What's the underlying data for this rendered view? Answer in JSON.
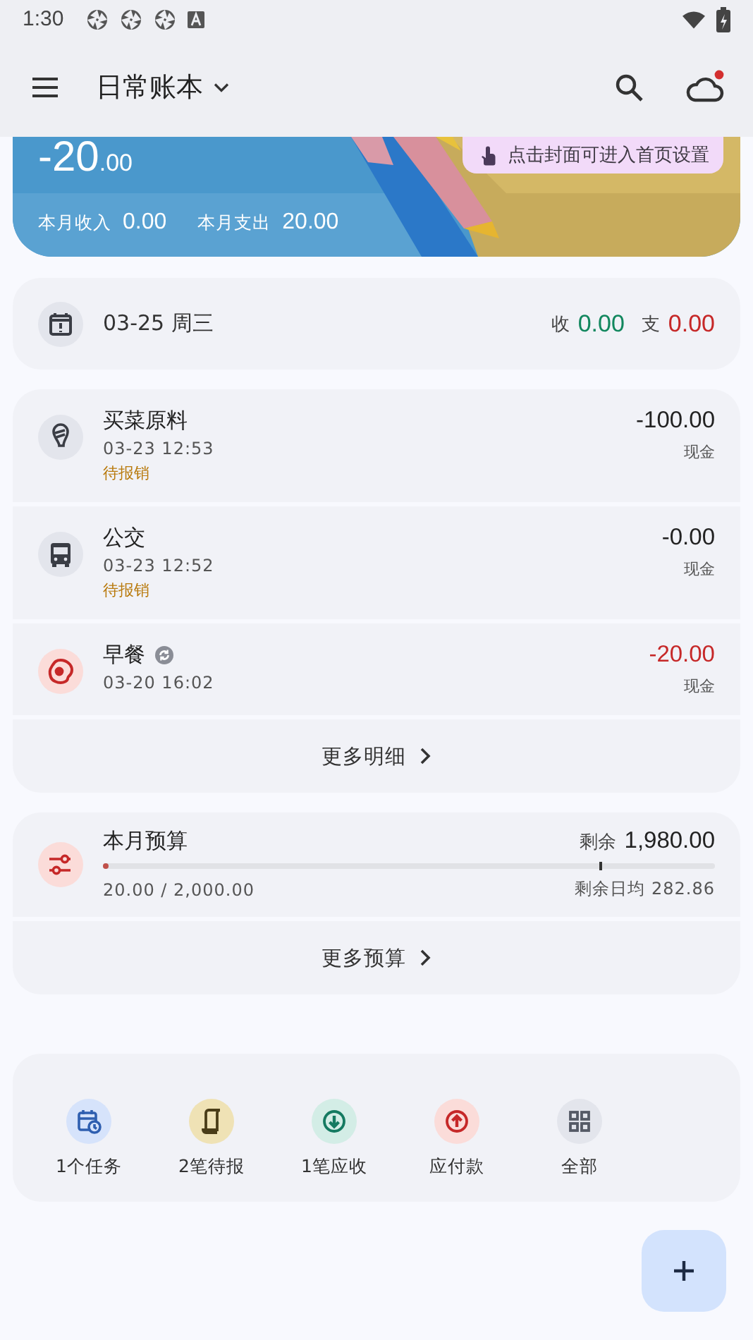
{
  "status_bar": {
    "time": "1:30"
  },
  "toolbar": {
    "title": "日常账本"
  },
  "banner": {
    "balance_main": "-20",
    "balance_decimals": ".00",
    "hint": "点击封面可进入首页设置",
    "income_label": "本月收入",
    "income": "0.00",
    "expense_label": "本月支出",
    "expense": "20.00"
  },
  "day_summary": {
    "date": "03-25 周三",
    "income_label": "收",
    "income": "0.00",
    "expense_label": "支",
    "expense": "0.00"
  },
  "transactions": [
    {
      "kind": "food",
      "title": "买菜原料",
      "time": "03-23 12:53",
      "tag": "待报销",
      "amount": "-100.00",
      "account": "现金",
      "red": false,
      "recurring": false
    },
    {
      "kind": "bus",
      "title": "公交",
      "time": "03-23 12:52",
      "tag": "待报销",
      "amount": "-0.00",
      "account": "现金",
      "red": false,
      "recurring": false
    },
    {
      "kind": "egg",
      "title": "早餐",
      "time": "03-20 16:02",
      "amount": "-20.00",
      "account": "现金",
      "red": true,
      "recurring": true
    }
  ],
  "more_details": "更多明细",
  "budget": {
    "title": "本月预算",
    "remain_label": "剩余",
    "remain": "1,980.00",
    "used": "20.00 / 2,000.00",
    "daily": "剩余日均 282.86",
    "level": 0.01,
    "day_marker": {
      "level": 0.81
    }
  },
  "more_budget": "更多预算",
  "shortcuts": [
    {
      "kind": "task",
      "label": "1个任务"
    },
    {
      "kind": "reimburse",
      "label": "2笔待报"
    },
    {
      "kind": "receivable",
      "label": "1笔应收"
    },
    {
      "kind": "payable",
      "label": "应付款"
    },
    {
      "kind": "all",
      "label": "全部"
    }
  ]
}
